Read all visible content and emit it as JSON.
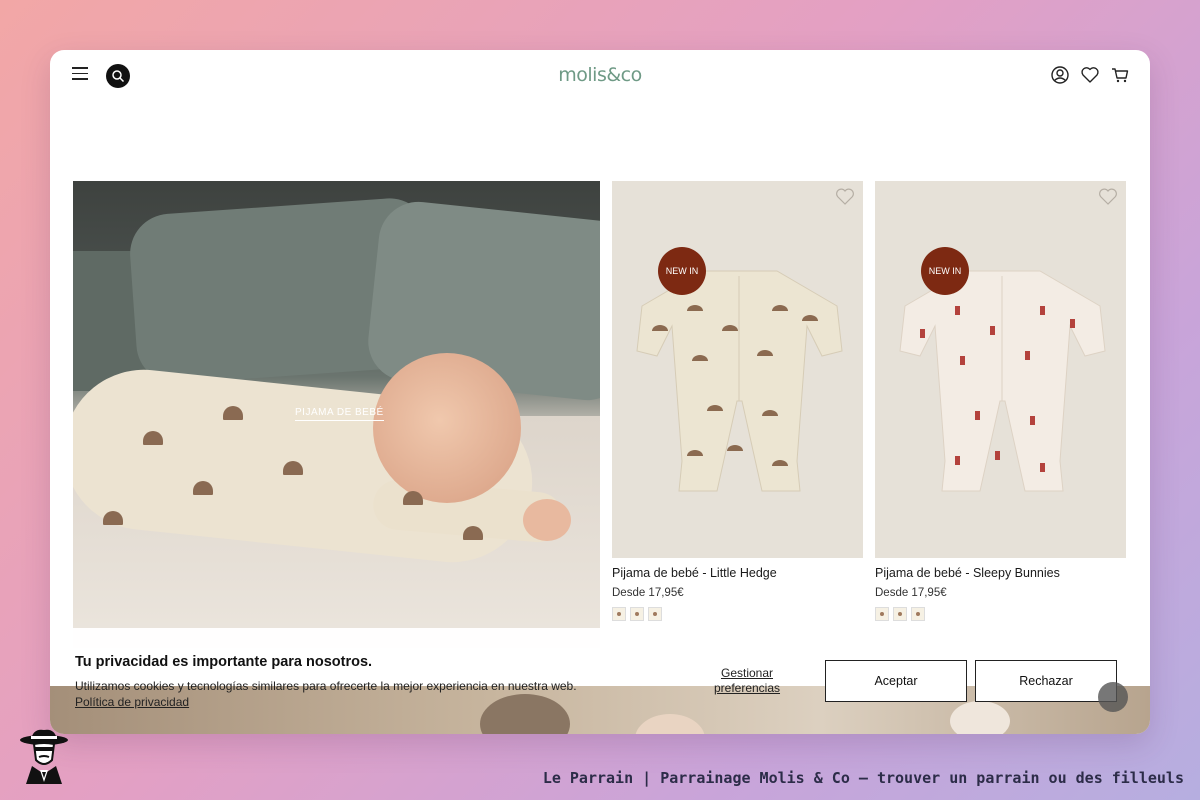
{
  "header": {
    "logo": "molis&co",
    "menu_icon": "hamburger-menu-icon",
    "search_icon": "search-icon",
    "account_icon": "user-icon",
    "wishlist_icon": "heart-icon",
    "cart_icon": "shopping-cart-icon"
  },
  "hero": {
    "label": "PIJAMA DE BEBÉ"
  },
  "products": [
    {
      "badge": "NEW IN",
      "name": "Pijama de bebé - Little Hedge",
      "price": "Desde 17,95€",
      "swatch_count": 3,
      "color": "#ece5d2",
      "print": "#8b6a50"
    },
    {
      "badge": "NEW IN",
      "name": "Pijama de bebé - Sleepy Bunnies",
      "price": "Desde 17,95€",
      "swatch_count": 3,
      "color": "#f3ece4",
      "print": "#b3423c"
    }
  ],
  "cookie": {
    "title": "Tu privacidad es importante para nosotros.",
    "text": "Utilizamos cookies y tecnologías similares para ofrecerte la mejor experiencia en nuestra web.",
    "policy_link": "Política de privacidad",
    "manage": "Gestionar preferencias",
    "accept": "Aceptar",
    "reject": "Rechazar"
  },
  "footer": {
    "title": "Le Parrain | Parrainage Molis & Co — trouver un parrain ou des filleuls",
    "logo_icon": "mafia-man-logo-icon"
  },
  "colors": {
    "logo": "#6f9a86",
    "badge": "#7d2912",
    "footer_text": "#2c2c48"
  }
}
